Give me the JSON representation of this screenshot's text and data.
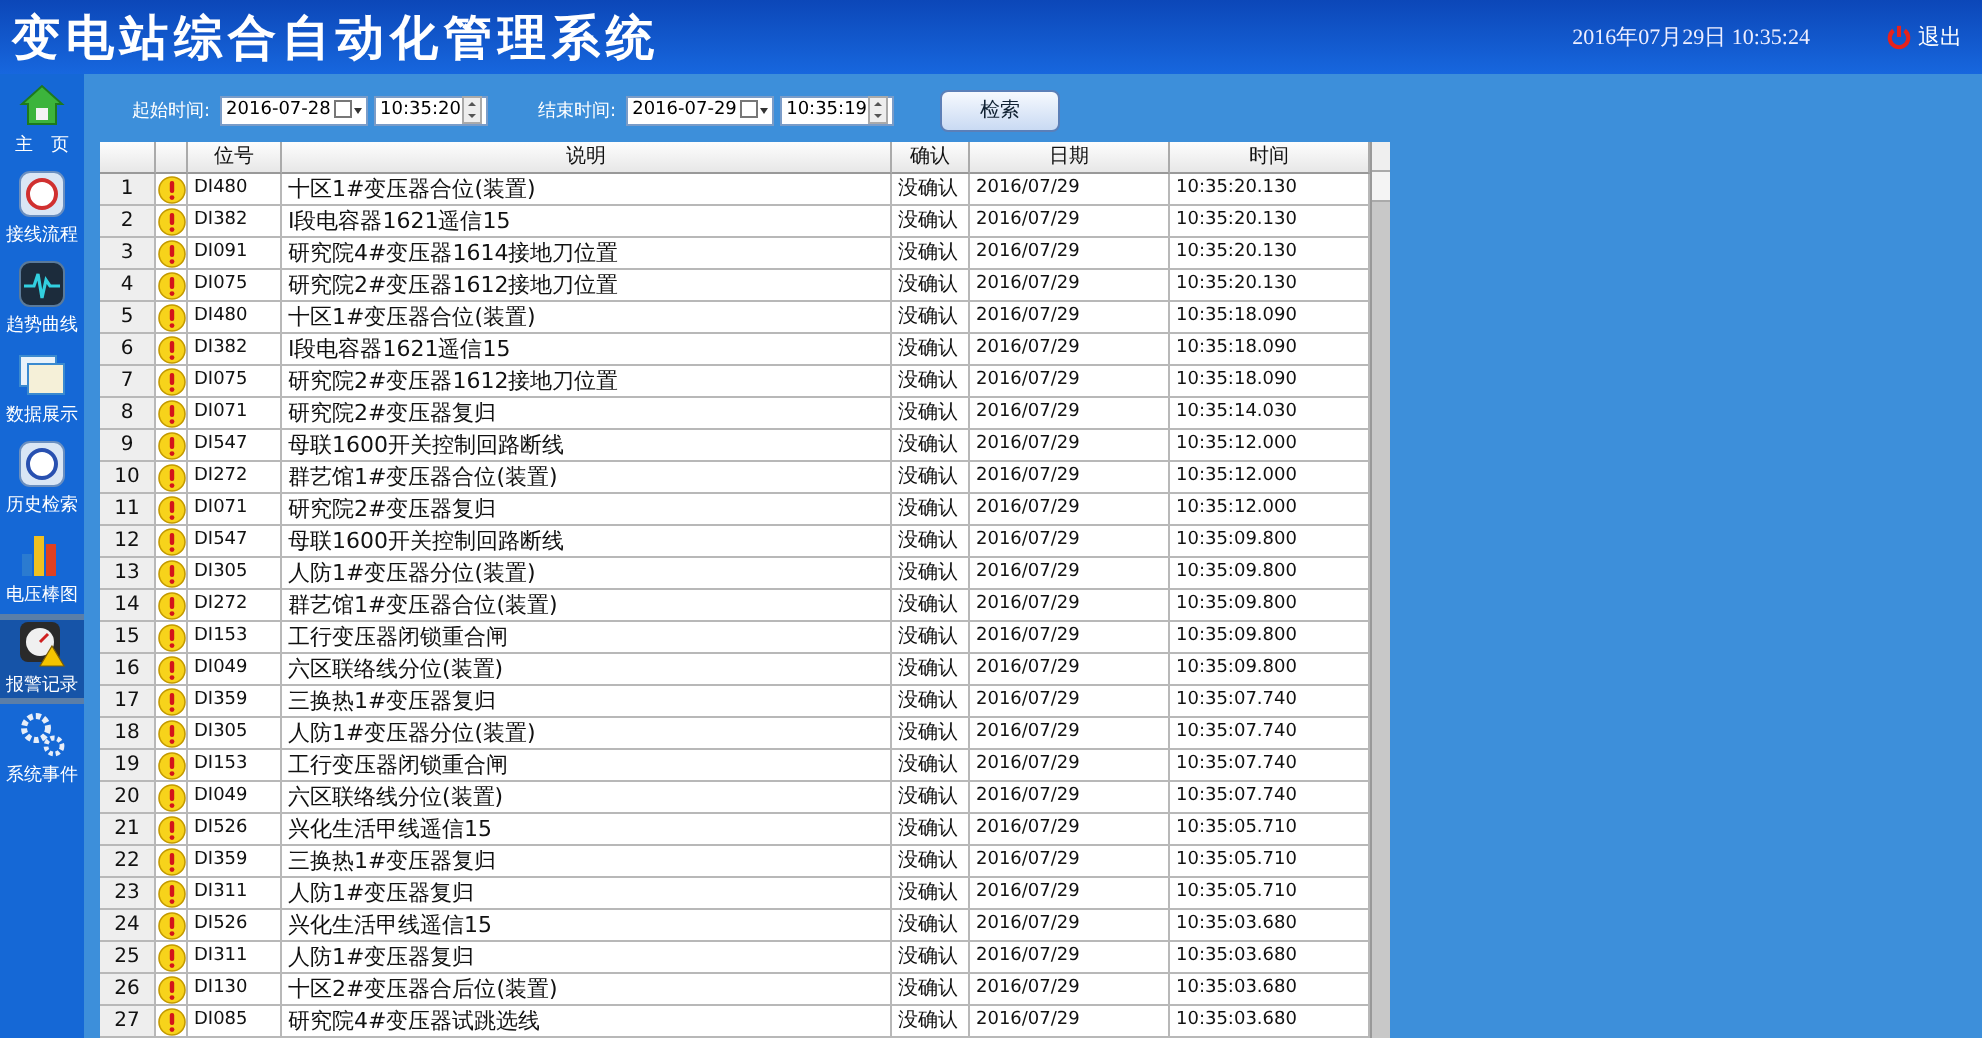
{
  "header": {
    "title": "变电站综合自动化管理系统",
    "datetime": "2016年07月29日  10:35:24",
    "exit_label": "退出"
  },
  "sidebar": {
    "items": [
      {
        "label": "主　页",
        "kind": "home",
        "selected": false
      },
      {
        "label": "接线流程",
        "kind": "flow",
        "selected": false
      },
      {
        "label": "趋势曲线",
        "kind": "trend",
        "selected": false
      },
      {
        "label": "数据展示",
        "kind": "data",
        "selected": false
      },
      {
        "label": "历史检索",
        "kind": "history",
        "selected": false
      },
      {
        "label": "电压棒图",
        "kind": "bars",
        "selected": false
      },
      {
        "label": "报警记录",
        "kind": "alarm",
        "selected": true
      },
      {
        "label": "系统事件",
        "kind": "gears",
        "selected": false
      }
    ]
  },
  "filter": {
    "start_label": "起始时间:",
    "start_date": "2016-07-28",
    "start_time": "10:35:20",
    "end_label": "结束时间:",
    "end_date": "2016-07-29",
    "end_time": "10:35:19",
    "search_button": "检索"
  },
  "table": {
    "columns": [
      "位号",
      "说明",
      "确认",
      "日期",
      "时间"
    ],
    "rows": [
      {
        "index": "1",
        "tag": "DI480",
        "description": "十区1#变压器合位(装置)",
        "confirm": "没确认",
        "date": "2016/07/29",
        "time": "10:35:20.130"
      },
      {
        "index": "2",
        "tag": "DI382",
        "description": "I段电容器1621遥信15",
        "confirm": "没确认",
        "date": "2016/07/29",
        "time": "10:35:20.130"
      },
      {
        "index": "3",
        "tag": "DI091",
        "description": "研究院4#变压器1614接地刀位置",
        "confirm": "没确认",
        "date": "2016/07/29",
        "time": "10:35:20.130"
      },
      {
        "index": "4",
        "tag": "DI075",
        "description": "研究院2#变压器1612接地刀位置",
        "confirm": "没确认",
        "date": "2016/07/29",
        "time": "10:35:20.130"
      },
      {
        "index": "5",
        "tag": "DI480",
        "description": "十区1#变压器合位(装置)",
        "confirm": "没确认",
        "date": "2016/07/29",
        "time": "10:35:18.090"
      },
      {
        "index": "6",
        "tag": "DI382",
        "description": "I段电容器1621遥信15",
        "confirm": "没确认",
        "date": "2016/07/29",
        "time": "10:35:18.090"
      },
      {
        "index": "7",
        "tag": "DI075",
        "description": "研究院2#变压器1612接地刀位置",
        "confirm": "没确认",
        "date": "2016/07/29",
        "time": "10:35:18.090"
      },
      {
        "index": "8",
        "tag": "DI071",
        "description": "研究院2#变压器复归",
        "confirm": "没确认",
        "date": "2016/07/29",
        "time": "10:35:14.030"
      },
      {
        "index": "9",
        "tag": "DI547",
        "description": "母联1600开关控制回路断线",
        "confirm": "没确认",
        "date": "2016/07/29",
        "time": "10:35:12.000"
      },
      {
        "index": "10",
        "tag": "DI272",
        "description": "群艺馆1#变压器合位(装置)",
        "confirm": "没确认",
        "date": "2016/07/29",
        "time": "10:35:12.000"
      },
      {
        "index": "11",
        "tag": "DI071",
        "description": "研究院2#变压器复归",
        "confirm": "没确认",
        "date": "2016/07/29",
        "time": "10:35:12.000"
      },
      {
        "index": "12",
        "tag": "DI547",
        "description": "母联1600开关控制回路断线",
        "confirm": "没确认",
        "date": "2016/07/29",
        "time": "10:35:09.800"
      },
      {
        "index": "13",
        "tag": "DI305",
        "description": "人防1#变压器分位(装置)",
        "confirm": "没确认",
        "date": "2016/07/29",
        "time": "10:35:09.800"
      },
      {
        "index": "14",
        "tag": "DI272",
        "description": "群艺馆1#变压器合位(装置)",
        "confirm": "没确认",
        "date": "2016/07/29",
        "time": "10:35:09.800"
      },
      {
        "index": "15",
        "tag": "DI153",
        "description": "工行变压器闭锁重合闸",
        "confirm": "没确认",
        "date": "2016/07/29",
        "time": "10:35:09.800"
      },
      {
        "index": "16",
        "tag": "DI049",
        "description": "六区联络线分位(装置)",
        "confirm": "没确认",
        "date": "2016/07/29",
        "time": "10:35:09.800"
      },
      {
        "index": "17",
        "tag": "DI359",
        "description": "三换热1#变压器复归",
        "confirm": "没确认",
        "date": "2016/07/29",
        "time": "10:35:07.740"
      },
      {
        "index": "18",
        "tag": "DI305",
        "description": "人防1#变压器分位(装置)",
        "confirm": "没确认",
        "date": "2016/07/29",
        "time": "10:35:07.740"
      },
      {
        "index": "19",
        "tag": "DI153",
        "description": "工行变压器闭锁重合闸",
        "confirm": "没确认",
        "date": "2016/07/29",
        "time": "10:35:07.740"
      },
      {
        "index": "20",
        "tag": "DI049",
        "description": "六区联络线分位(装置)",
        "confirm": "没确认",
        "date": "2016/07/29",
        "time": "10:35:07.740"
      },
      {
        "index": "21",
        "tag": "DI526",
        "description": "兴化生活甲线遥信15",
        "confirm": "没确认",
        "date": "2016/07/29",
        "time": "10:35:05.710"
      },
      {
        "index": "22",
        "tag": "DI359",
        "description": "三换热1#变压器复归",
        "confirm": "没确认",
        "date": "2016/07/29",
        "time": "10:35:05.710"
      },
      {
        "index": "23",
        "tag": "DI311",
        "description": "人防1#变压器复归",
        "confirm": "没确认",
        "date": "2016/07/29",
        "time": "10:35:05.710"
      },
      {
        "index": "24",
        "tag": "DI526",
        "description": "兴化生活甲线遥信15",
        "confirm": "没确认",
        "date": "2016/07/29",
        "time": "10:35:03.680"
      },
      {
        "index": "25",
        "tag": "DI311",
        "description": "人防1#变压器复归",
        "confirm": "没确认",
        "date": "2016/07/29",
        "time": "10:35:03.680"
      },
      {
        "index": "26",
        "tag": "DI130",
        "description": "十区2#变压器合后位(装置)",
        "confirm": "没确认",
        "date": "2016/07/29",
        "time": "10:35:03.680"
      },
      {
        "index": "27",
        "tag": "DI085",
        "description": "研究院4#变压器试跳选线",
        "confirm": "没确认",
        "date": "2016/07/29",
        "time": "10:35:03.680"
      }
    ]
  }
}
